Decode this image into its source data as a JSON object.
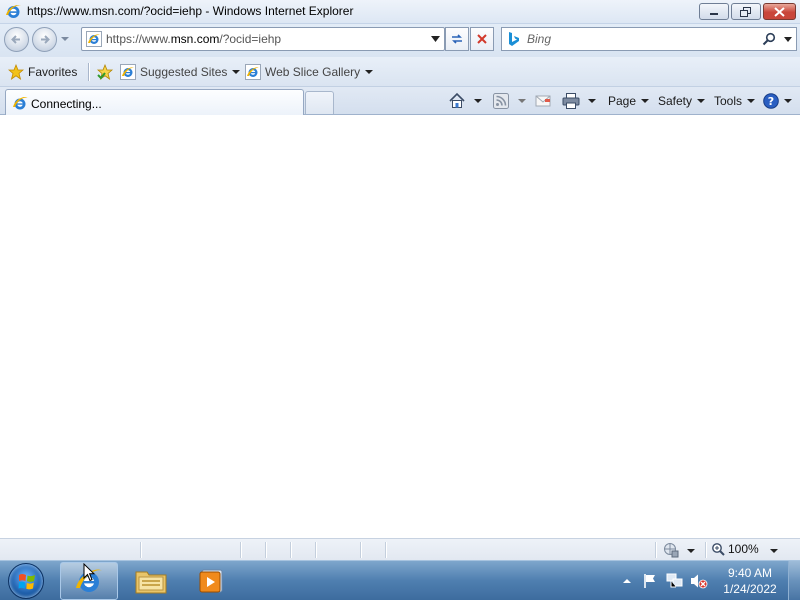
{
  "window": {
    "title": "https://www.msn.com/?ocid=iehp - Windows Internet Explorer"
  },
  "address_bar": {
    "url_prefix": "https://www.",
    "url_domain": "msn.com",
    "url_suffix": "/?ocid=iehp"
  },
  "search": {
    "placeholder": "Bing"
  },
  "favorites_bar": {
    "favorites_label": "Favorites",
    "items": [
      {
        "label": "Suggested Sites"
      },
      {
        "label": "Web Slice Gallery"
      }
    ]
  },
  "tabs": [
    {
      "label": "Connecting..."
    }
  ],
  "command_bar": {
    "page_label": "Page",
    "safety_label": "Safety",
    "tools_label": "Tools"
  },
  "status_bar": {
    "zoom": "100%"
  },
  "taskbar": {
    "time": "9:40 AM",
    "date": "1/24/2022"
  },
  "colors": {
    "ie_blue": "#1a6fc9",
    "ie_gold": "#f0b400",
    "close_red": "#c9463a"
  }
}
